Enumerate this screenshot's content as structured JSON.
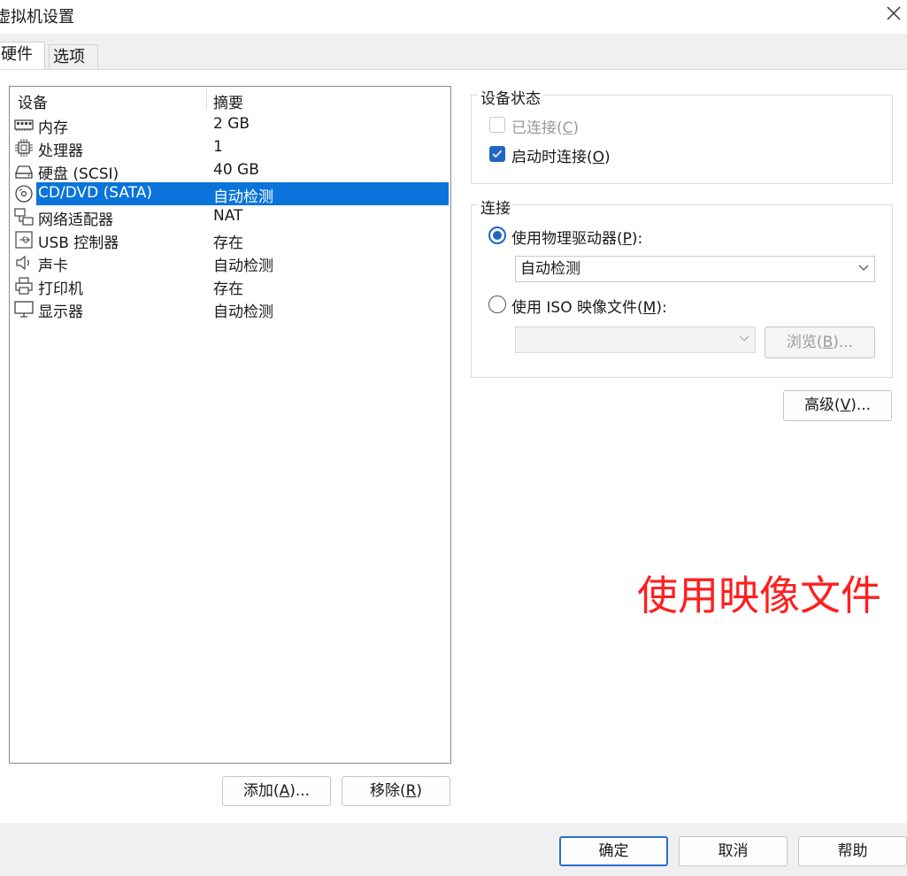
{
  "window": {
    "title": "虚拟机设置"
  },
  "tabs": [
    {
      "label": "硬件",
      "active": true
    },
    {
      "label": "选项",
      "active": false
    }
  ],
  "device_list": {
    "columns": [
      "设备",
      "摘要"
    ],
    "rows": [
      {
        "icon": "memory-icon",
        "name": "内存",
        "summary": "2 GB",
        "selected": false
      },
      {
        "icon": "processor-icon",
        "name": "处理器",
        "summary": "1",
        "selected": false
      },
      {
        "icon": "hard-disk-icon",
        "name": "硬盘 (SCSI)",
        "summary": "40 GB",
        "selected": false
      },
      {
        "icon": "cd-dvd-icon",
        "name": "CD/DVD (SATA)",
        "summary": "自动检测",
        "selected": true
      },
      {
        "icon": "network-adapter-icon",
        "name": "网络适配器",
        "summary": "NAT",
        "selected": false
      },
      {
        "icon": "usb-icon",
        "name": "USB 控制器",
        "summary": "存在",
        "selected": false
      },
      {
        "icon": "sound-icon",
        "name": "声卡",
        "summary": "自动检测",
        "selected": false
      },
      {
        "icon": "printer-icon",
        "name": "打印机",
        "summary": "存在",
        "selected": false
      },
      {
        "icon": "display-icon",
        "name": "显示器",
        "summary": "自动检测",
        "selected": false
      }
    ],
    "add_button": {
      "pre": "添加(",
      "key": "A",
      "post": ")..."
    },
    "remove_button": {
      "pre": "移除(",
      "key": "R",
      "post": ")"
    }
  },
  "device_status": {
    "title": "设备状态",
    "connected": {
      "pre": "已连接(",
      "key": "C",
      "post": ")",
      "checked": false,
      "enabled": false
    },
    "connect_at_power_on": {
      "pre": "启动时连接(",
      "key": "O",
      "post": ")",
      "checked": true,
      "enabled": true
    }
  },
  "connection": {
    "title": "连接",
    "physical_drive": {
      "pre": "使用物理驱动器(",
      "key": "P",
      "post": "):",
      "selected": true,
      "value": "自动检测"
    },
    "iso_image": {
      "pre": "使用 ISO 映像文件(",
      "key": "M",
      "post": "):",
      "selected": false,
      "value": ""
    },
    "browse_button": {
      "pre": "浏览(",
      "key": "B",
      "post": ")..."
    }
  },
  "advanced_button": {
    "pre": "高级(",
    "key": "V",
    "post": ")..."
  },
  "footer": {
    "ok_label": "确定",
    "cancel_label": "取消",
    "help_label": "帮助"
  },
  "annotation": {
    "text": "使用映像文件",
    "color": "#ff1f1f"
  },
  "colors": {
    "selection": "#0a74da",
    "accent": "#1f66c4"
  }
}
